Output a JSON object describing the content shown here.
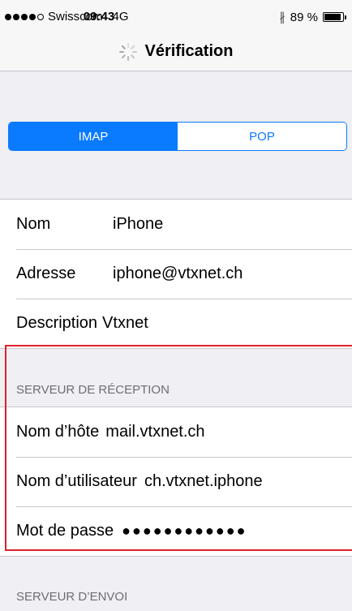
{
  "status_bar": {
    "carrier": "Swisscom",
    "network": "4G",
    "time": "09:43",
    "battery": "89 %",
    "battery_level": 0.89,
    "signal_bars": 4
  },
  "nav": {
    "title": "Vérification"
  },
  "segmented": {
    "options": [
      "IMAP",
      "POP"
    ],
    "selected": "IMAP"
  },
  "account": {
    "rows": [
      {
        "label": "Nom",
        "value": "iPhone"
      },
      {
        "label": "Adresse",
        "value": "iphone@vtxnet.ch"
      },
      {
        "label": "Description",
        "value": "Vtxnet"
      }
    ]
  },
  "incoming": {
    "header": "SERVEUR DE RÉCEPTION",
    "rows": [
      {
        "label": "Nom d’hôte",
        "value": "mail.vtxnet.ch"
      },
      {
        "label": "Nom d’utilisateur",
        "value": "ch.vtxnet.iphone"
      },
      {
        "label": "Mot de passe",
        "value": "●●●●●●●●●●●●"
      }
    ]
  },
  "outgoing": {
    "header": "SERVEUR D’ENVOI"
  },
  "colors": {
    "accent": "#0a7aff",
    "highlight": "#e0202c",
    "background": "#efeff4"
  }
}
